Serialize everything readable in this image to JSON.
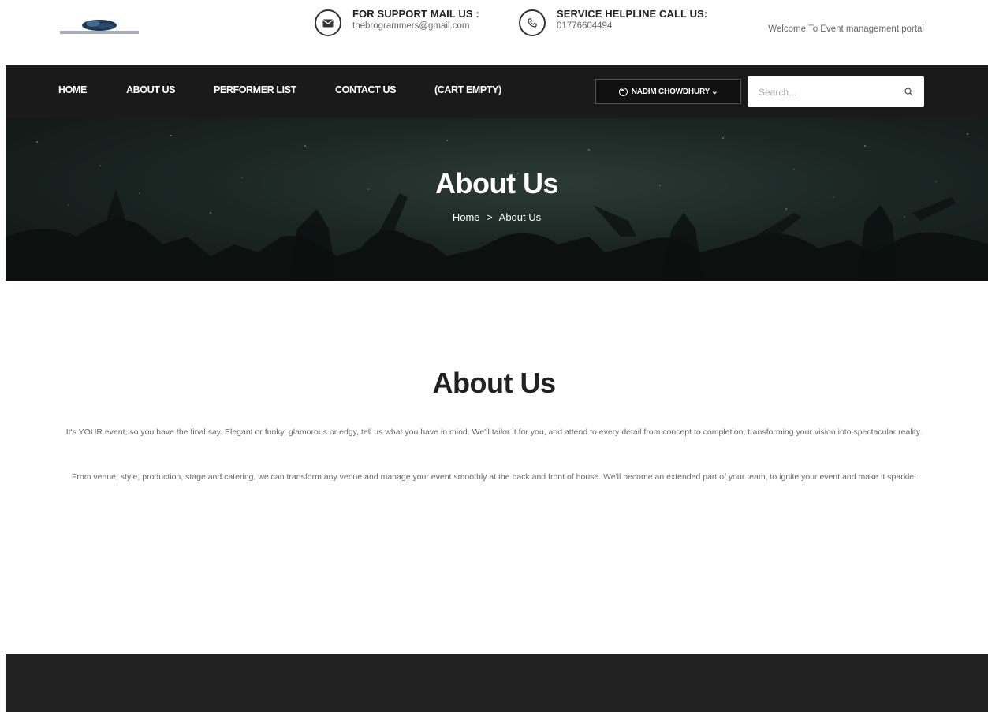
{
  "header": {
    "logo_alt": "BROGRAMMERS",
    "support_title": "FOR SUPPORT MAIL US :",
    "support_email": "thebrogrammers@gmail.com",
    "helpline_title": "SERVICE HELPLINE CALL US:",
    "helpline_phone": "01776604494",
    "welcome": "Welcome To Event management portal"
  },
  "nav": {
    "items": [
      {
        "label": "HOME"
      },
      {
        "label": "ABOUT US"
      },
      {
        "label": "PERFORMER LIST"
      },
      {
        "label": "CONTACT US"
      },
      {
        "label": "(CART EMPTY)"
      }
    ],
    "user_label": "NADIM CHOWDHURY",
    "user_chevron": "⌄",
    "search_placeholder": "Search..."
  },
  "hero": {
    "title": "About Us",
    "breadcrumb_home": "Home",
    "breadcrumb_sep": ">",
    "breadcrumb_current": "About Us"
  },
  "content": {
    "title": "About Us",
    "paragraph1": "It's YOUR event, so you have the final say. Elegant or funky, glamorous or edgy, tell us what you have in mind. We'll tailor it for you, and attend to every detail from concept to completion, transforming your vision into spectacular reality.",
    "paragraph2": "From venue, style, production, stage and catering, we can transform any venue and manage your event smoothly at the back and front of house. We'll become an extended part of your team, to ignite your event and make it sparkle!"
  },
  "icons": {
    "mail": "envelope-icon",
    "phone": "phone-icon",
    "user": "user-circle-icon",
    "search": "search-icon"
  },
  "colors": {
    "nav_bg": "#1a1a1a",
    "footer_bg": "#212121",
    "hero_bg": "#1b2623"
  }
}
